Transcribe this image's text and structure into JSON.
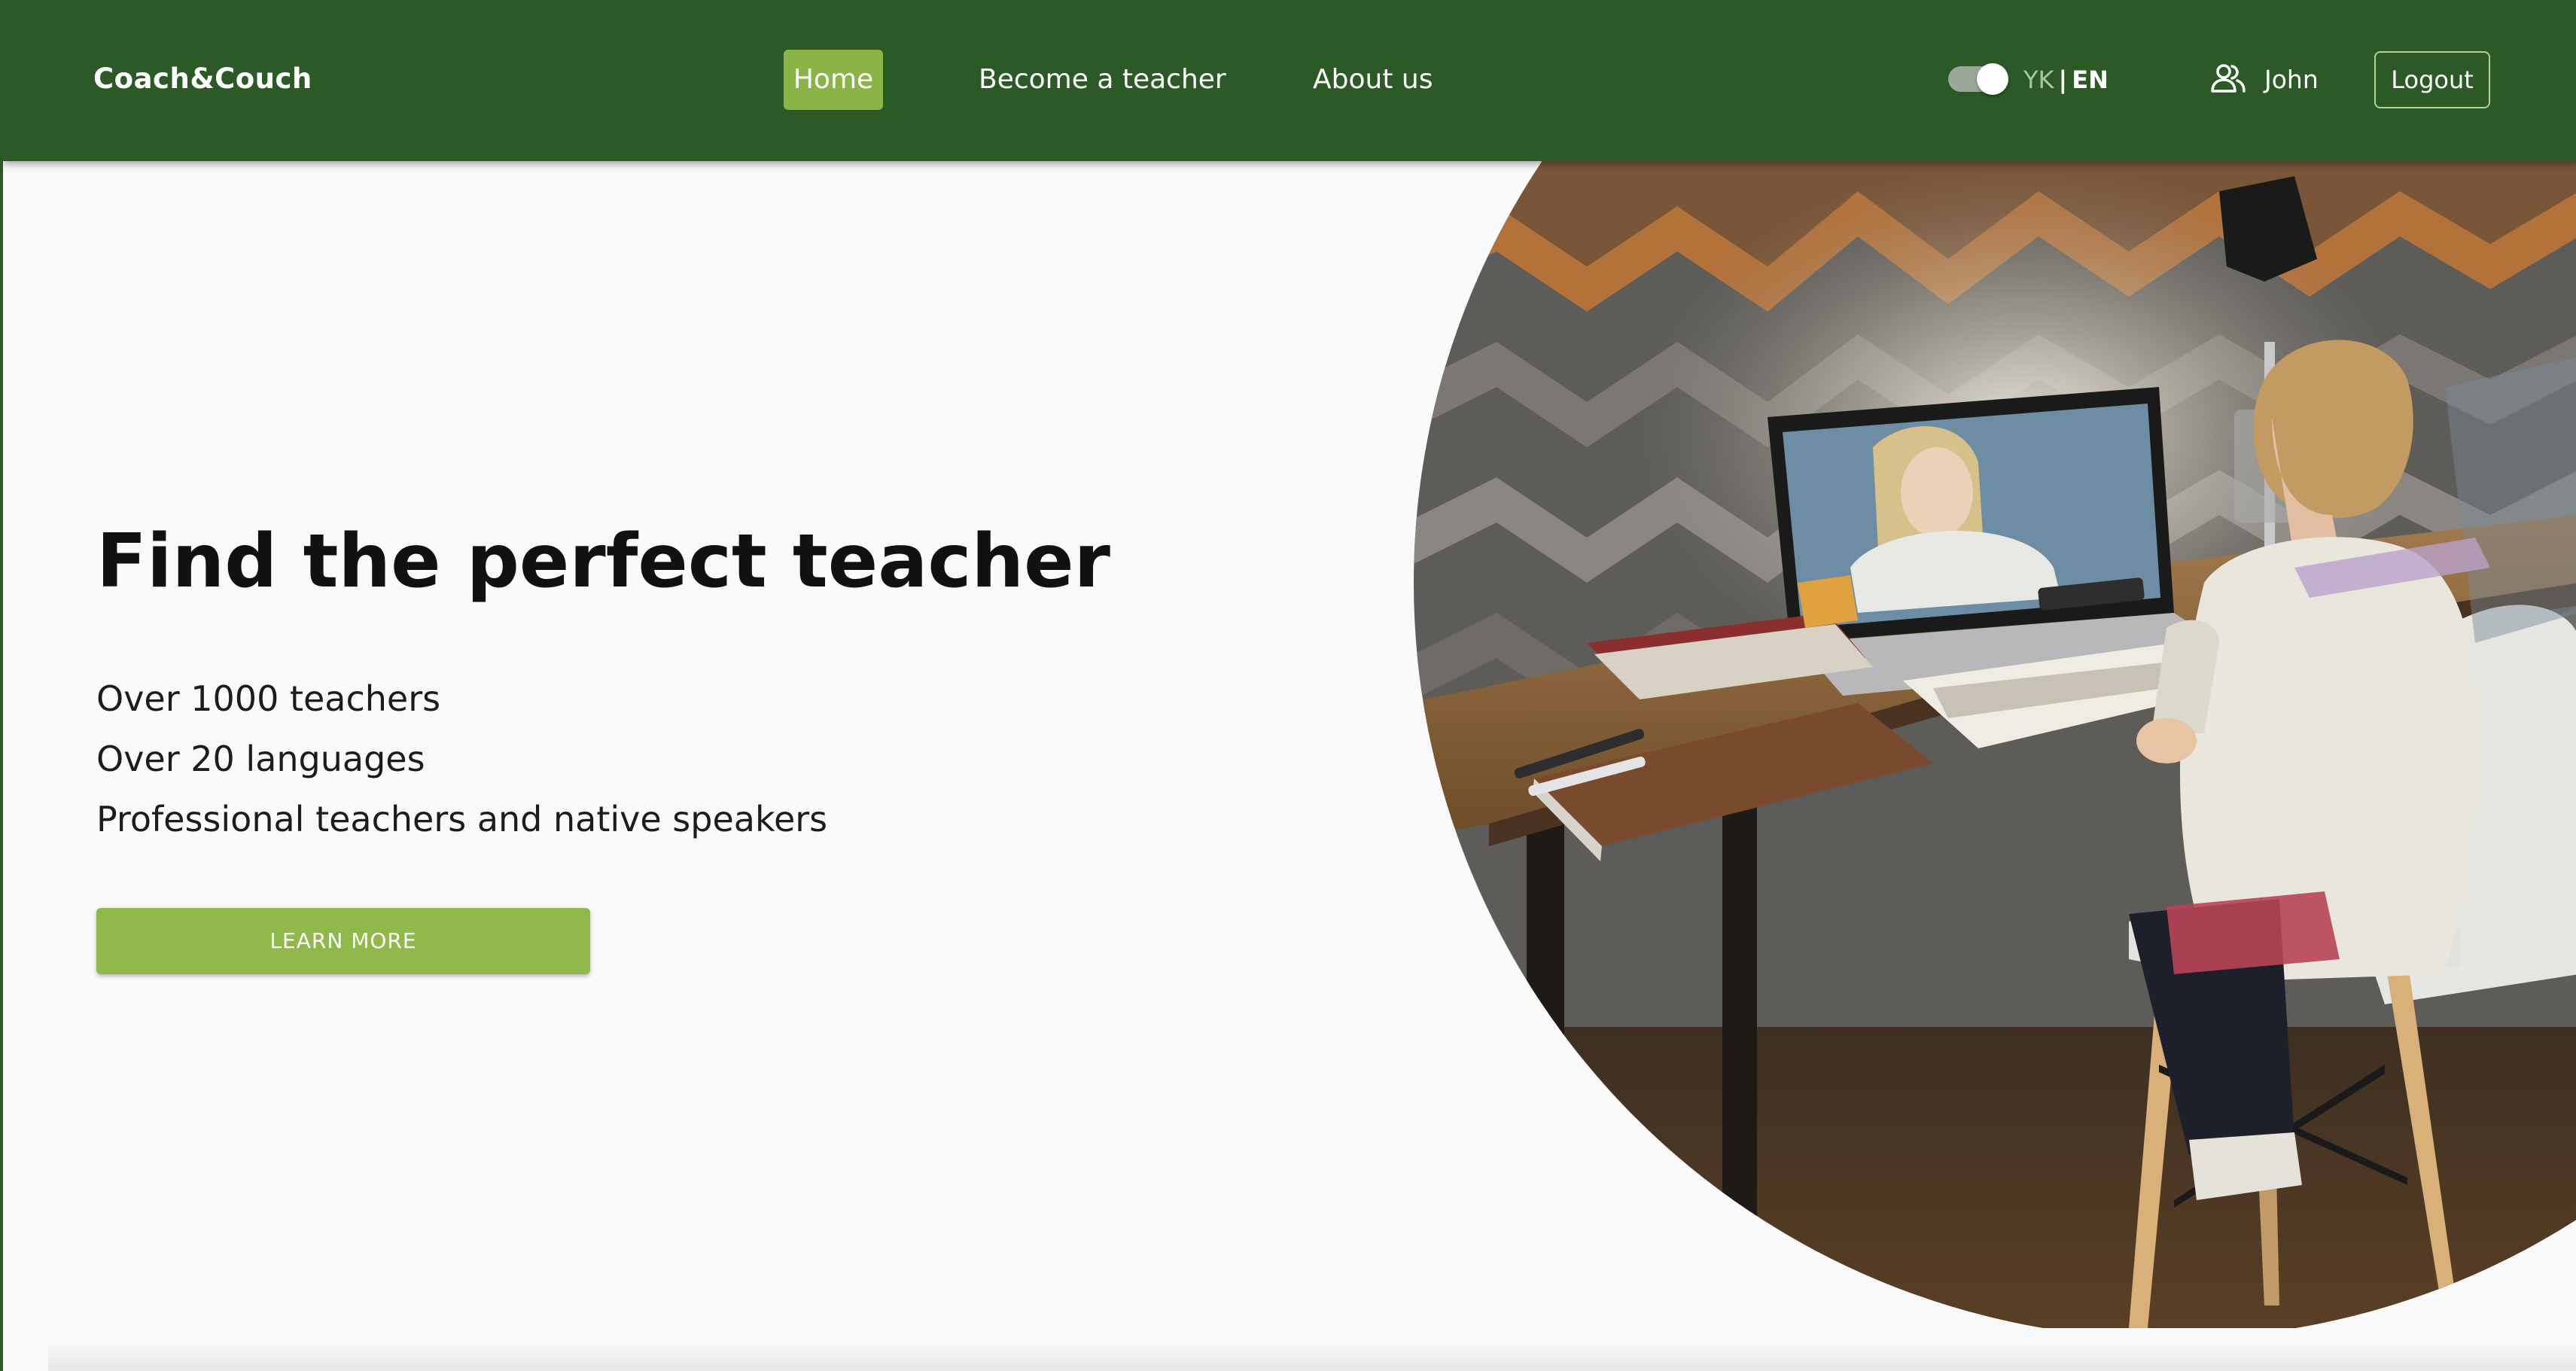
{
  "header": {
    "logo": "Coach&Couch",
    "nav": [
      {
        "label": "Home",
        "active": true
      },
      {
        "label": "Become a teacher",
        "active": false
      },
      {
        "label": "About us",
        "active": false
      }
    ],
    "language": {
      "option_uk": "YK",
      "separator": "|",
      "option_en": "EN",
      "toggle_on": true
    },
    "user": {
      "icon": "user-group-icon",
      "name": "John"
    },
    "logout_label": "Logout"
  },
  "hero": {
    "title": "Find the perfect teacher",
    "features": [
      "Over 1000 teachers",
      "Over 20 languages",
      "Professional teachers and native speakers"
    ],
    "cta_label": "LEARN MORE",
    "image_alt": "child learning online at a desk with a laptop"
  },
  "colors": {
    "header_bg": "#2b5a26",
    "accent_green": "#8ab446",
    "button_green": "#90b84a",
    "page_bg": "#fafafa"
  }
}
